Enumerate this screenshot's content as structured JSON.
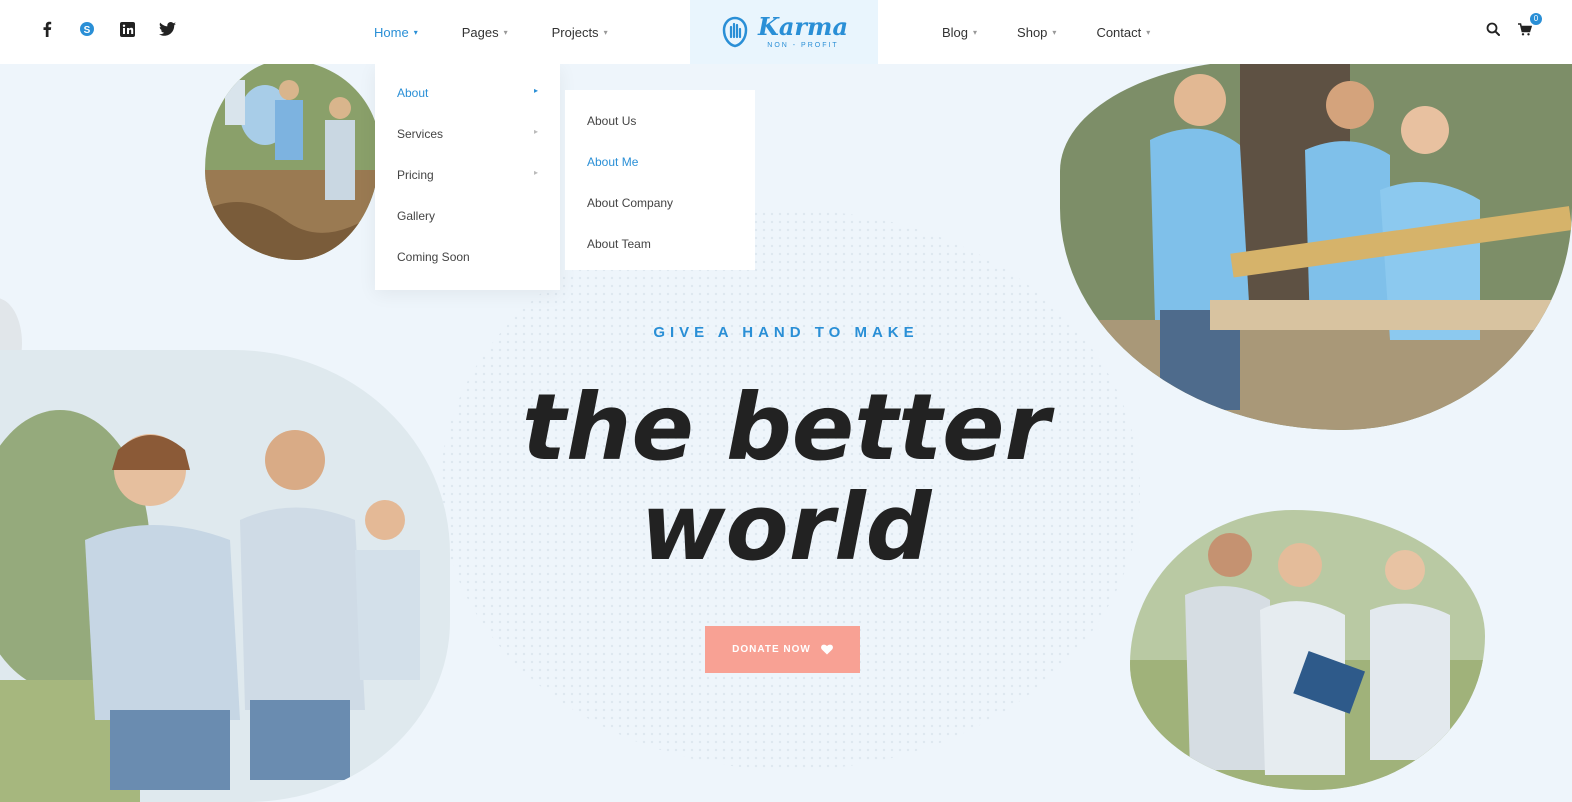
{
  "header": {
    "social": [
      "facebook-icon",
      "skype-icon",
      "linkedin-icon",
      "twitter-icon"
    ],
    "nav_left": [
      {
        "label": "Home",
        "active": true
      },
      {
        "label": "Pages",
        "active": false
      },
      {
        "label": "Projects",
        "active": false
      }
    ],
    "nav_right": [
      {
        "label": "Blog"
      },
      {
        "label": "Shop"
      },
      {
        "label": "Contact"
      }
    ],
    "logo": {
      "name": "Karma",
      "sub": "NON - PROFIT"
    },
    "cart_count": "0"
  },
  "dropdown": {
    "items": [
      "About",
      "Services",
      "Pricing",
      "Gallery",
      "Coming Soon"
    ],
    "submenu": [
      "About Us",
      "About Me",
      "About Company",
      "About Team"
    ]
  },
  "hero": {
    "tagline": "GIVE A HAND TO MAKE",
    "line1": "the better",
    "line2": "world",
    "donate_label": "DONATE NOW"
  },
  "colors": {
    "accent": "#2a8fd6",
    "donate": "#f8a194",
    "text": "#222222"
  }
}
